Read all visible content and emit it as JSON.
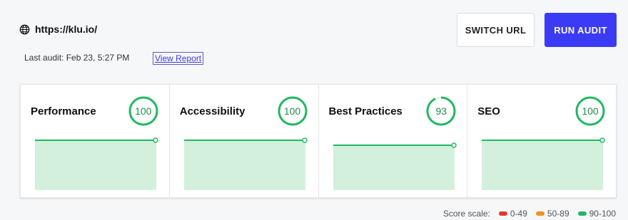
{
  "header": {
    "url": "https://klu.io/",
    "last_audit": "Last audit: Feb 23, 5:27 PM",
    "view_report": "View Report",
    "switch_url": "SWITCH URL",
    "run_audit": "RUN AUDIT"
  },
  "cards": [
    {
      "title": "Performance",
      "score": "100",
      "score_fraction": 1.0,
      "trend": [
        100,
        100
      ]
    },
    {
      "title": "Accessibility",
      "score": "100",
      "score_fraction": 1.0,
      "trend": [
        100,
        100
      ]
    },
    {
      "title": "Best Practices",
      "score": "93",
      "score_fraction": 0.93,
      "trend": [
        93,
        93
      ]
    },
    {
      "title": "SEO",
      "score": "100",
      "score_fraction": 1.0,
      "trend": [
        100,
        100
      ]
    }
  ],
  "scale": {
    "label": "Score scale:",
    "ranges": [
      {
        "label": "0-49",
        "color": "#e03c31"
      },
      {
        "label": "50-89",
        "color": "#f0921e"
      },
      {
        "label": "90-100",
        "color": "#22b861"
      }
    ]
  },
  "colors": {
    "accent": "#3b3bf5",
    "good": "#22b861",
    "good_fill": "#d3f0dc"
  },
  "icons": {
    "url": "globe-icon"
  }
}
